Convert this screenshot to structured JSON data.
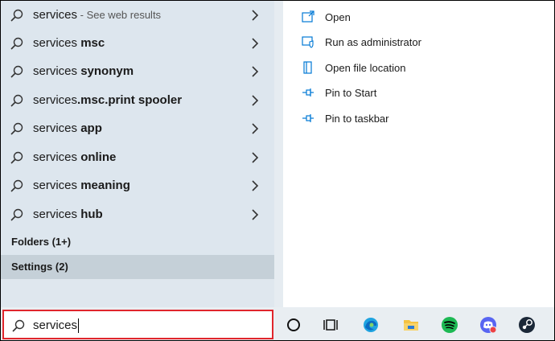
{
  "results": [
    {
      "prefix": "services",
      "bold": "",
      "hint": " - See web results"
    },
    {
      "prefix": "services ",
      "bold": "msc",
      "hint": ""
    },
    {
      "prefix": "services ",
      "bold": "synonym",
      "hint": ""
    },
    {
      "prefix": "services",
      "bold": ".msc.print spooler",
      "hint": ""
    },
    {
      "prefix": "services ",
      "bold": "app",
      "hint": ""
    },
    {
      "prefix": "services ",
      "bold": "online",
      "hint": ""
    },
    {
      "prefix": "services ",
      "bold": "meaning",
      "hint": ""
    },
    {
      "prefix": "services ",
      "bold": "hub",
      "hint": ""
    }
  ],
  "sections": {
    "folders": "Folders (1+)",
    "settings": "Settings (2)"
  },
  "actions": [
    {
      "label": "Open",
      "icon": "open-icon"
    },
    {
      "label": "Run as administrator",
      "icon": "shield-icon"
    },
    {
      "label": "Open file location",
      "icon": "file-location-icon"
    },
    {
      "label": "Pin to Start",
      "icon": "pin-icon"
    },
    {
      "label": "Pin to taskbar",
      "icon": "pin-icon"
    }
  ],
  "search": {
    "query": "services"
  },
  "taskbar": {
    "icons": [
      "cortana-icon",
      "task-view-icon",
      "edge-icon",
      "file-explorer-icon",
      "spotify-icon",
      "discord-icon",
      "steam-icon"
    ]
  },
  "colors": {
    "panel_bg": "#dde6ee",
    "selected_bg": "#c5d0d8",
    "accent": "#0078d4",
    "search_border": "#e0262c"
  }
}
